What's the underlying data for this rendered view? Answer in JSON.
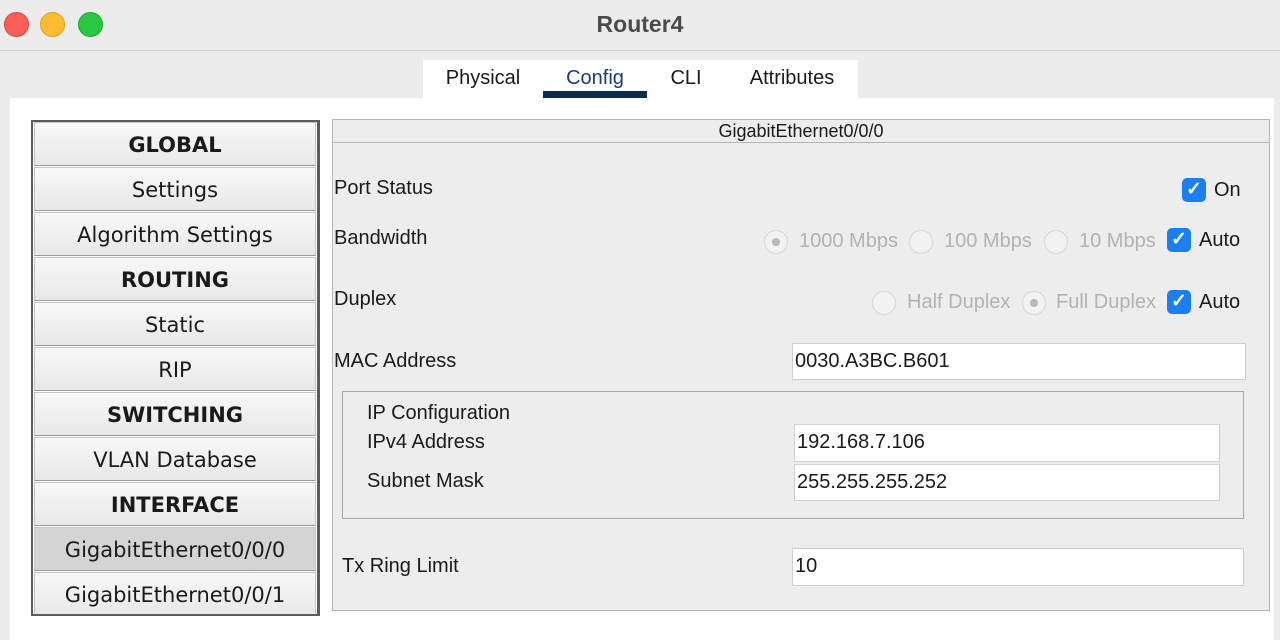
{
  "window": {
    "title": "Router4"
  },
  "tabs": [
    {
      "label": "Physical"
    },
    {
      "label": "Config"
    },
    {
      "label": "CLI"
    },
    {
      "label": "Attributes"
    }
  ],
  "active_tab": "Config",
  "sidebar": {
    "items": [
      {
        "label": "GLOBAL",
        "kind": "header"
      },
      {
        "label": "Settings",
        "kind": "item"
      },
      {
        "label": "Algorithm Settings",
        "kind": "item"
      },
      {
        "label": "ROUTING",
        "kind": "header"
      },
      {
        "label": "Static",
        "kind": "item"
      },
      {
        "label": "RIP",
        "kind": "item"
      },
      {
        "label": "SWITCHING",
        "kind": "header"
      },
      {
        "label": "VLAN Database",
        "kind": "item"
      },
      {
        "label": "INTERFACE",
        "kind": "header"
      },
      {
        "label": "GigabitEthernet0/0/0",
        "kind": "item",
        "selected": true
      },
      {
        "label": "GigabitEthernet0/0/1",
        "kind": "item"
      }
    ]
  },
  "interface": {
    "title": "GigabitEthernet0/0/0",
    "port_status": {
      "label": "Port Status",
      "on_label": "On",
      "checked": true
    },
    "bandwidth": {
      "label": "Bandwidth",
      "options": [
        "1000 Mbps",
        "100 Mbps",
        "10 Mbps"
      ],
      "selected": "1000 Mbps",
      "auto_label": "Auto",
      "auto_checked": true
    },
    "duplex": {
      "label": "Duplex",
      "options": [
        "Half Duplex",
        "Full Duplex"
      ],
      "selected": "Full Duplex",
      "auto_label": "Auto",
      "auto_checked": true
    },
    "mac": {
      "label": "MAC Address",
      "value": "0030.A3BC.B601"
    },
    "ip_config": {
      "title": "IP Configuration",
      "ipv4_label": "IPv4 Address",
      "ipv4_value": "192.168.7.106",
      "mask_label": "Subnet Mask",
      "mask_value": "255.255.255.252"
    },
    "tx_ring": {
      "label": "Tx Ring Limit",
      "value": "10"
    }
  },
  "colors": {
    "checkbox": "#1a7ff5",
    "active_tab_underline": "#0f2a4f"
  }
}
